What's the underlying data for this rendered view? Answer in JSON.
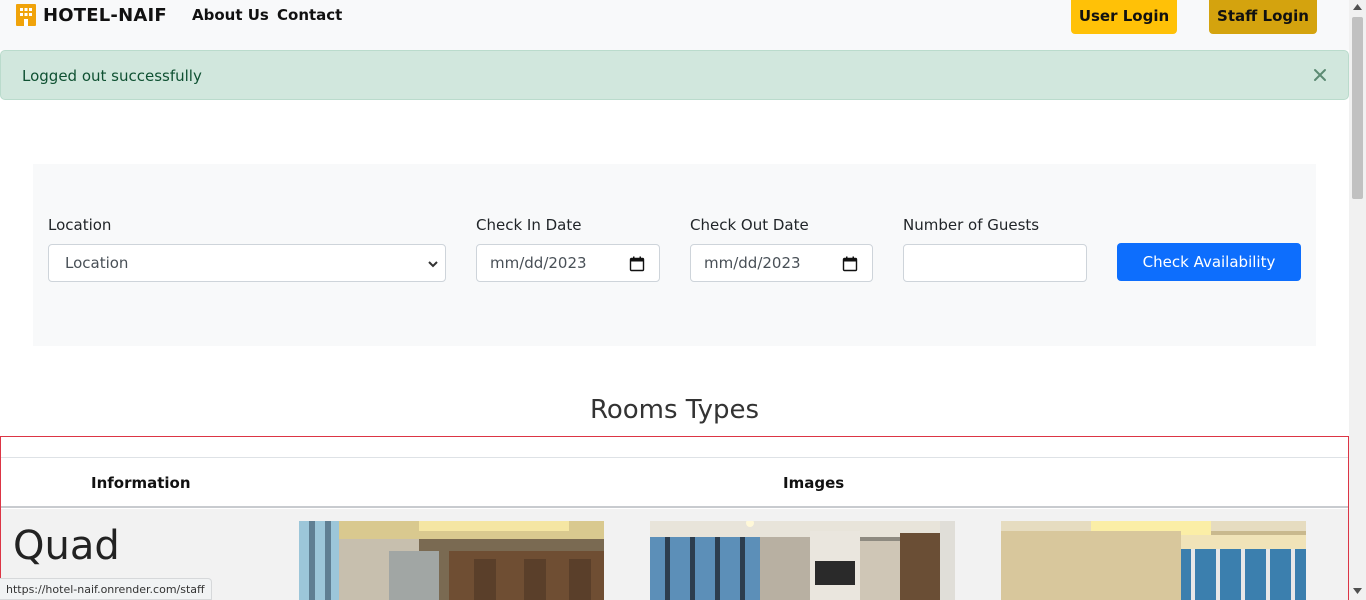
{
  "navbar": {
    "brand": "HOTEL-NAIF",
    "brand_icon": "hotel-building-icon",
    "links": [
      "About Us",
      "Contact"
    ],
    "user_login": "User Login",
    "staff_login": "Staff Login",
    "colors": {
      "user_login_bg": "#ffc107",
      "staff_login_bg": "#d4a30e"
    }
  },
  "alert": {
    "message": "Logged out successfully",
    "close_icon": "close-icon",
    "color": "#d1e7dd"
  },
  "search": {
    "location_label": "Location",
    "location_value": "Location",
    "check_in_label": "Check In Date",
    "check_in_value": "mm/dd/2023",
    "check_out_label": "Check Out Date",
    "check_out_value": "mm/dd/2023",
    "guests_label": "Number of Guests",
    "guests_value": "",
    "button": "Check Availability",
    "button_color": "#0d6efd"
  },
  "rooms": {
    "title": "Rooms Types",
    "columns": [
      "Information",
      "Images"
    ],
    "rows": [
      {
        "name": "Quad",
        "images": [
          "room-photo-1",
          "room-photo-2",
          "room-photo-3"
        ]
      }
    ]
  },
  "status_bar": {
    "url": "https://hotel-naif.onrender.com/staff"
  }
}
